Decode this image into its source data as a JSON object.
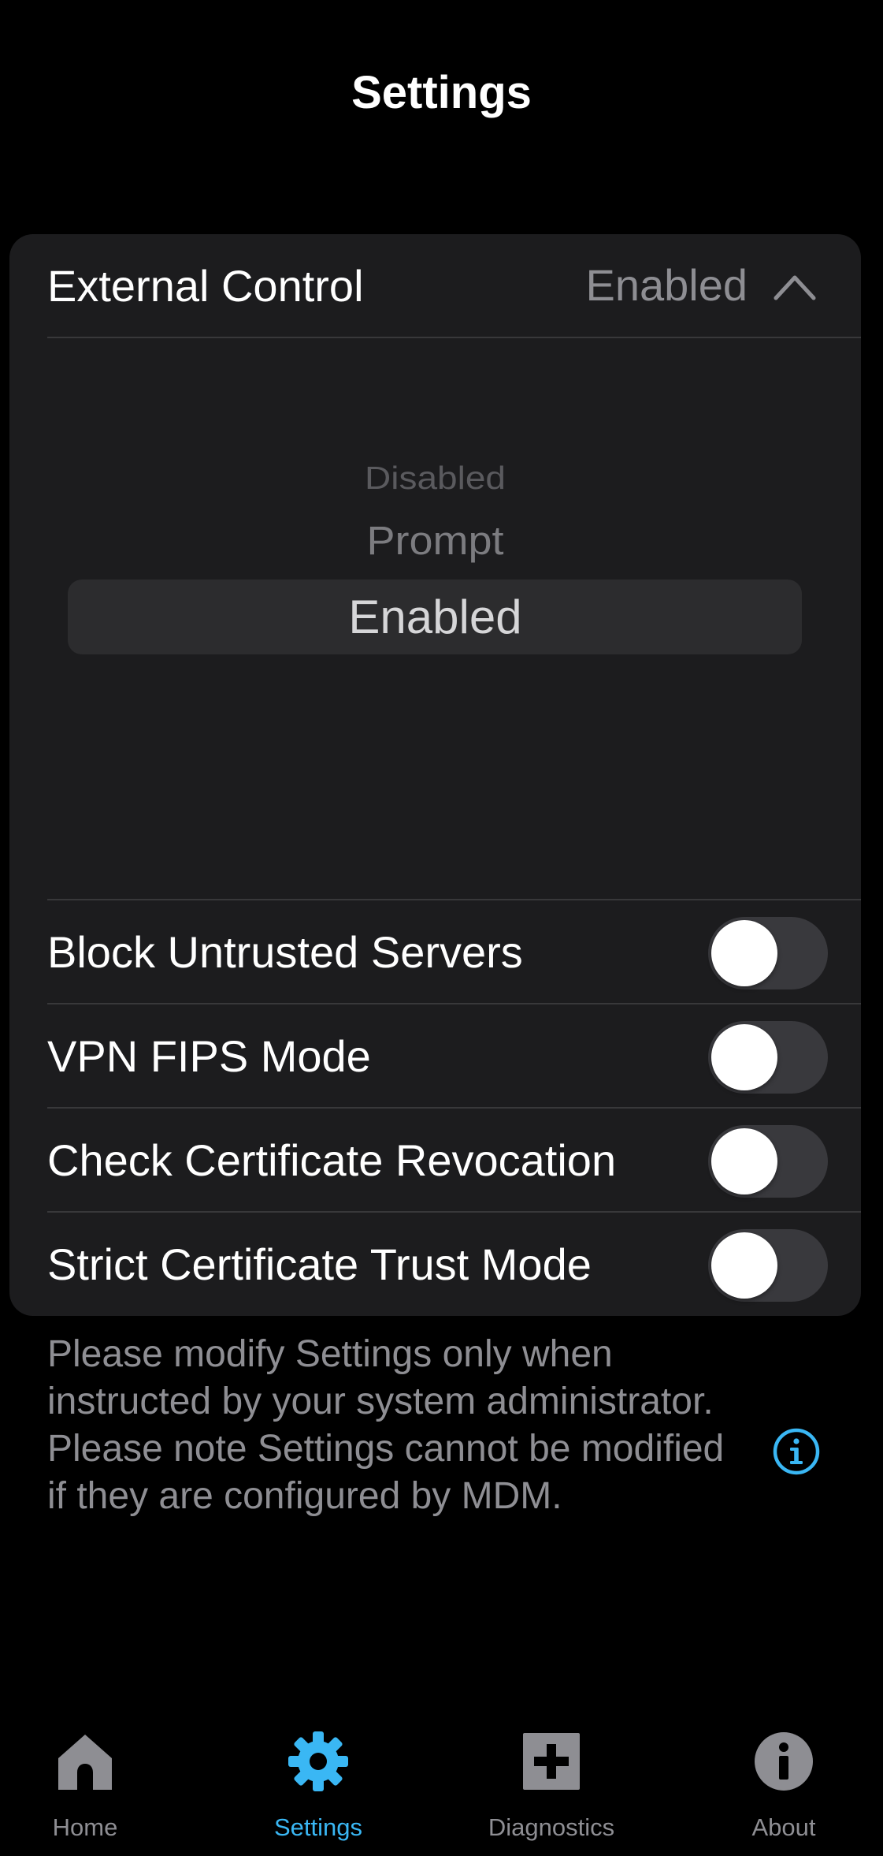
{
  "header": {
    "title": "Settings"
  },
  "external_control": {
    "label": "External Control",
    "value": "Enabled",
    "expanded": true,
    "picker": {
      "options": [
        "Disabled",
        "Prompt",
        "Enabled"
      ],
      "selected": "Enabled"
    }
  },
  "toggles": [
    {
      "label": "Block Untrusted Servers",
      "on": false
    },
    {
      "label": "VPN FIPS Mode",
      "on": false
    },
    {
      "label": "Check Certificate Revocation",
      "on": false
    },
    {
      "label": "Strict Certificate Trust Mode",
      "on": false
    }
  ],
  "footer_note": {
    "text": "Please modify Settings only when instructed by your system administrator. Please note Settings cannot be modified if they are configured by MDM.",
    "icon": "info-icon"
  },
  "tabbar": {
    "active": "Settings",
    "tabs": [
      {
        "label": "Home",
        "icon": "home-icon"
      },
      {
        "label": "Settings",
        "icon": "gear-icon"
      },
      {
        "label": "Diagnostics",
        "icon": "diagnostics-icon"
      },
      {
        "label": "About",
        "icon": "about-icon"
      }
    ]
  },
  "colors": {
    "accent": "#3ab7f4",
    "background": "#000000",
    "card": "#1c1c1e",
    "secondary_text": "#8e8e93"
  }
}
